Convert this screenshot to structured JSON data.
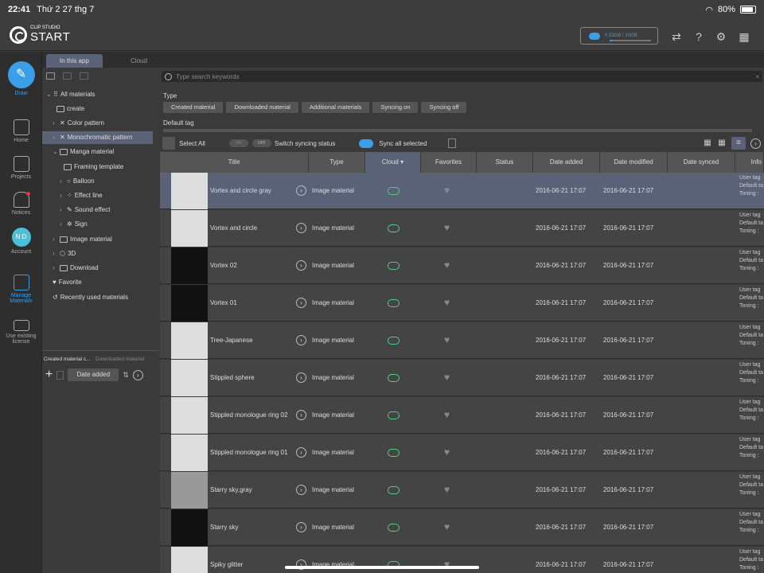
{
  "status_bar": {
    "time": "22:41",
    "date": "Thứ 2 27 thg 7",
    "battery": "80%"
  },
  "header": {
    "logo_top": "CLIP STUDIO",
    "logo_main": "START",
    "storage_text": "0.53GB / 10GB",
    "storage_fraction": 0.053
  },
  "left_nav": {
    "draw": "Draw",
    "home": "Home",
    "projects": "Projects",
    "notices": "Notices",
    "account_initials": "N D",
    "account": "Account",
    "manage_materials": "Manage Materials",
    "use_license": "Use existing license"
  },
  "tabs": {
    "in_app": "In this app",
    "cloud": "Cloud"
  },
  "tree": {
    "items": [
      {
        "label": "All materials"
      },
      {
        "label": "create"
      },
      {
        "label": "Color pattern"
      },
      {
        "label": "Monochromatic pattern"
      },
      {
        "label": "Manga material"
      },
      {
        "label": "Framing template"
      },
      {
        "label": "Balloon"
      },
      {
        "label": "Effect line"
      },
      {
        "label": "Sound effect"
      },
      {
        "label": "Sign"
      },
      {
        "label": "Image material"
      },
      {
        "label": "3D"
      },
      {
        "label": "Download"
      },
      {
        "label": "Favorite"
      },
      {
        "label": "Recently used materials"
      }
    ]
  },
  "left_bottom": {
    "tab_created": "Created material c...",
    "tab_downloaded": "Downloaded material c...",
    "sort_label": "Date added"
  },
  "filters": {
    "search_placeholder": "Type search keywords",
    "type_label": "Type",
    "chips": [
      "Created material",
      "Downloaded material",
      "Additional materials",
      "Syncing on",
      "Syncing off"
    ],
    "default_tag_label": "Default tag"
  },
  "toolbar": {
    "select_all": "Select All",
    "toggle_on": "ON",
    "toggle_off": "OFF",
    "switch_syncing": "Switch syncing status",
    "sync_all": "Sync all selected"
  },
  "columns": [
    "Title",
    "Type",
    "Cloud",
    "Favorites",
    "Status",
    "Date added",
    "Date modified",
    "Date synced",
    "Info"
  ],
  "rows": [
    {
      "title": "Vortex and circle gray",
      "type": "Image material",
      "added": "2016-06-21 17:07",
      "modified": "2016-06-21 17:07"
    },
    {
      "title": "Vortex and circle",
      "type": "Image material",
      "added": "2016-06-21 17:07",
      "modified": "2016-06-21 17:07"
    },
    {
      "title": "Vortex 02",
      "type": "Image material",
      "added": "2016-06-21 17:07",
      "modified": "2016-06-21 17:07"
    },
    {
      "title": "Vortex 01",
      "type": "Image material",
      "added": "2016-06-21 17:07",
      "modified": "2016-06-21 17:07"
    },
    {
      "title": "Tree-Japanese",
      "type": "Image material",
      "added": "2016-06-21 17:07",
      "modified": "2016-06-21 17:07"
    },
    {
      "title": "Stippled sphere",
      "type": "Image material",
      "added": "2016-06-21 17:07",
      "modified": "2016-06-21 17:07"
    },
    {
      "title": "Stippled monologue ring 02",
      "type": "Image material",
      "added": "2016-06-21 17:07",
      "modified": "2016-06-21 17:07"
    },
    {
      "title": "Stippled monologue ring 01",
      "type": "Image material",
      "added": "2016-06-21 17:07",
      "modified": "2016-06-21 17:07"
    },
    {
      "title": "Starry sky,gray",
      "type": "Image material",
      "added": "2016-06-21 17:07",
      "modified": "2016-06-21 17:07"
    },
    {
      "title": "Starry sky",
      "type": "Image material",
      "added": "2016-06-21 17:07",
      "modified": "2016-06-21 17:07"
    },
    {
      "title": "Spiky glitter",
      "type": "Image material",
      "added": "2016-06-21 17:07",
      "modified": "2016-06-21 17:07"
    }
  ],
  "info_lines": [
    "User tag",
    "Default ta",
    "Toning :"
  ],
  "colors": {
    "accent": "#3a9fe8",
    "selected_row": "#5a6278",
    "cloud_synced": "#4cd080"
  }
}
